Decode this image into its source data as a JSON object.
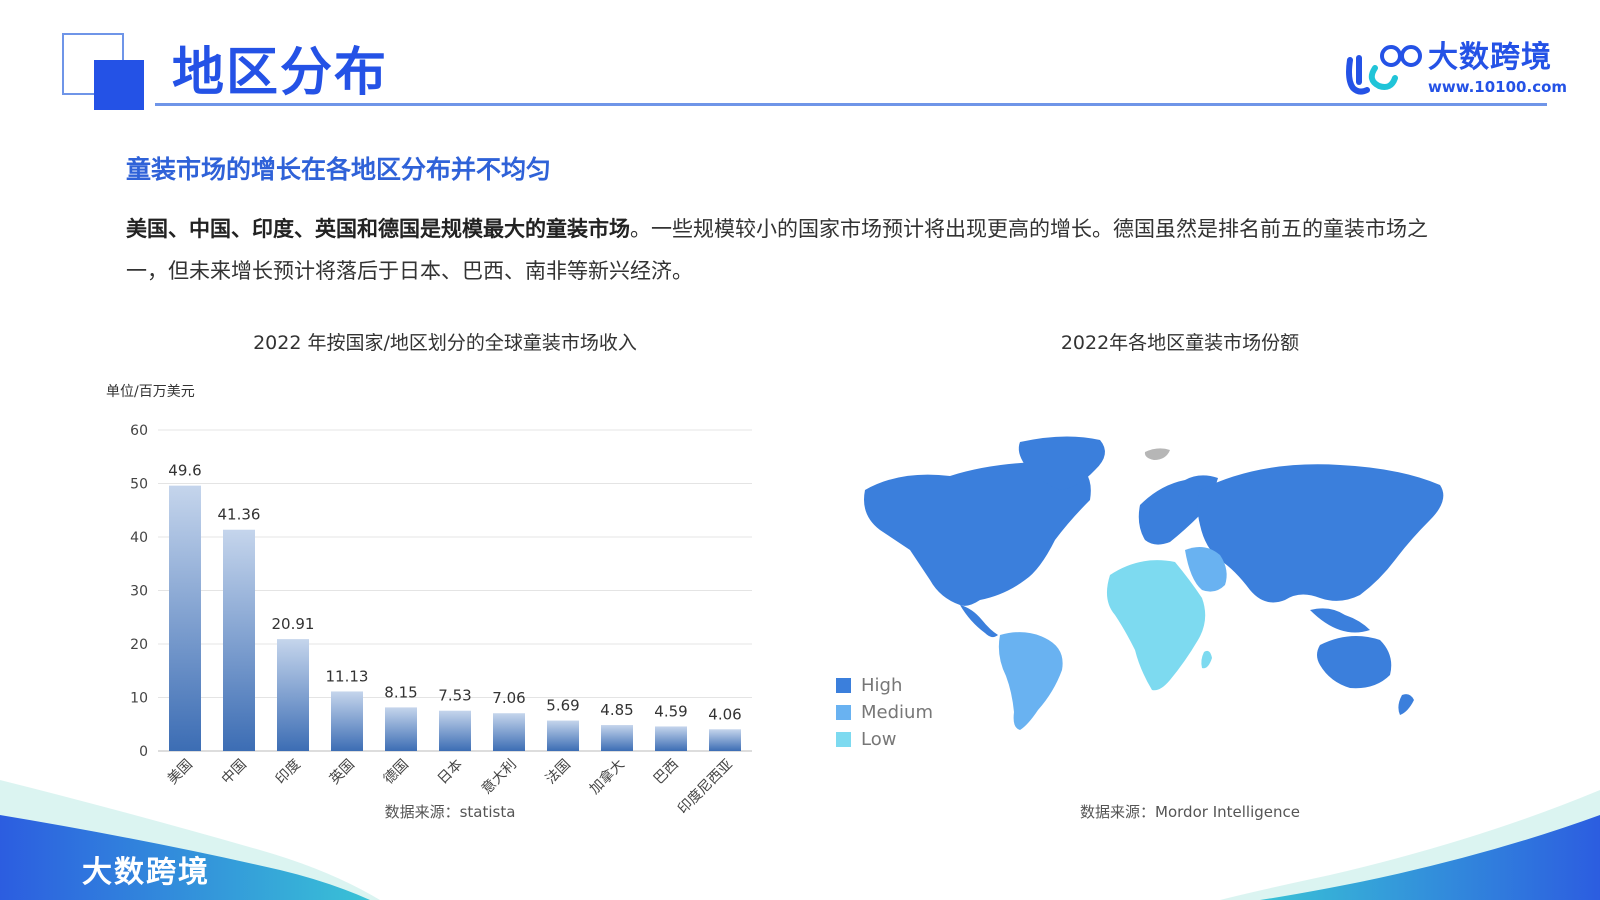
{
  "header": {
    "title": "地区分布",
    "brand_name": "大数跨境",
    "brand_url": "www.10100.com"
  },
  "section_heading": "童装市场的增长在各地区分布并不均匀",
  "paragraph": {
    "bold": "美国、中国、印度、英国和德国是规模最大的童装市场",
    "rest": "。一些规模较小的国家市场预计将出现更高的增长。德国虽然是排名前五的童装市场之一，但未来增长预计将落后于日本、巴西、南非等新兴经济。"
  },
  "chart_data": [
    {
      "type": "bar",
      "title": "2022 年按国家/地区划分的全球童装市场收入",
      "ylabel": "单位/百万美元",
      "categories": [
        "美国",
        "中国",
        "印度",
        "英国",
        "德国",
        "日本",
        "意大利",
        "法国",
        "加拿大",
        "巴西",
        "印度尼西亚"
      ],
      "values": [
        49.6,
        41.36,
        20.91,
        11.13,
        8.15,
        7.53,
        7.06,
        5.69,
        4.85,
        4.59,
        4.06
      ],
      "value_labels": [
        "49.6",
        "41.36",
        "20.91",
        "11.13",
        "8.15",
        "7.53",
        "7.06",
        "5.69",
        "4.85",
        "4.59",
        "4.06"
      ],
      "ylim": [
        0,
        60
      ],
      "yticks": [
        0,
        10,
        20,
        30,
        40,
        50,
        60
      ],
      "grid": true,
      "colors": {
        "bar_top": "#c5d5ec",
        "bar_bottom": "#3c6db4"
      },
      "source": "数据来源：statista"
    },
    {
      "type": "map",
      "title": "2022年各地区童装市场份额",
      "legend": [
        {
          "name": "High",
          "color": "#3b7fdc"
        },
        {
          "name": "Medium",
          "color": "#69b2f1"
        },
        {
          "name": "Low",
          "color": "#7ddaf0"
        }
      ],
      "legend_placement": "bottom-left",
      "source": "数据来源：Mordor Intelligence"
    }
  ],
  "footer": {
    "brand_name": "大数跨境"
  }
}
